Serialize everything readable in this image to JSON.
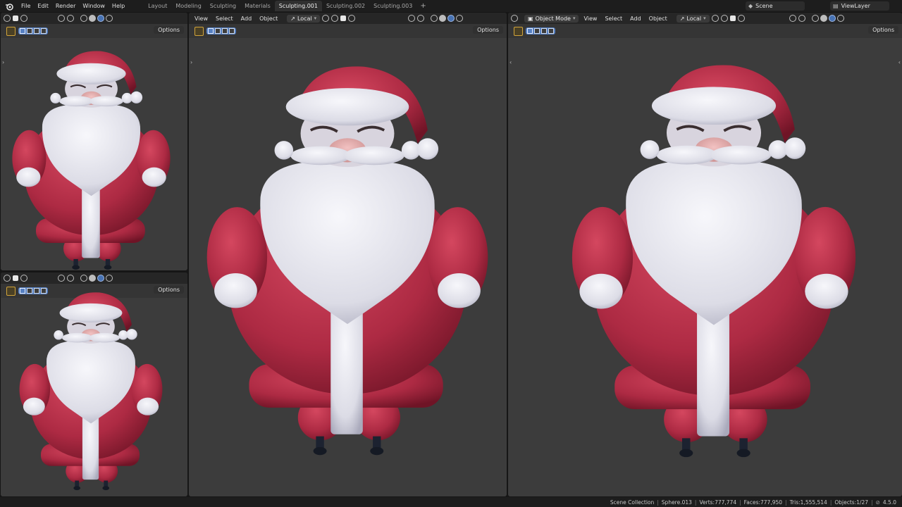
{
  "menu": [
    "File",
    "Edit",
    "Render",
    "Window",
    "Help"
  ],
  "workspaces": [
    "Layout",
    "Modeling",
    "Sculpting",
    "Materials",
    "Sculpting.001",
    "Sculpting.002",
    "Sculpting.003"
  ],
  "active_workspace_index": 4,
  "add_workspace": "+",
  "scene": "Scene",
  "view_layer": "ViewLayer",
  "viewports": {
    "left_top": {
      "options": "Options"
    },
    "left_bottom": {
      "options": "Options"
    },
    "middle": {
      "menus": [
        "View",
        "Select",
        "Add",
        "Object"
      ],
      "orientation": "Local",
      "options": "Options"
    },
    "right": {
      "mode": "Object Mode",
      "menus": [
        "View",
        "Select",
        "Add",
        "Object"
      ],
      "orientation": "Local",
      "options": "Options"
    }
  },
  "status": {
    "collection": "Scene Collection",
    "object": "Sphere.013",
    "verts": "Verts:777,774",
    "faces": "Faces:777,950",
    "tris": "Tris:1,555,514",
    "objects": "Objects:1/27",
    "version": "4.5.0"
  },
  "colors": {
    "viewport_bg": "#3c3c3c",
    "header_bg": "#262626",
    "accent_blue": "#5680c2",
    "santa_red": "#b8304a",
    "fur_white": "#e6e6ee"
  }
}
